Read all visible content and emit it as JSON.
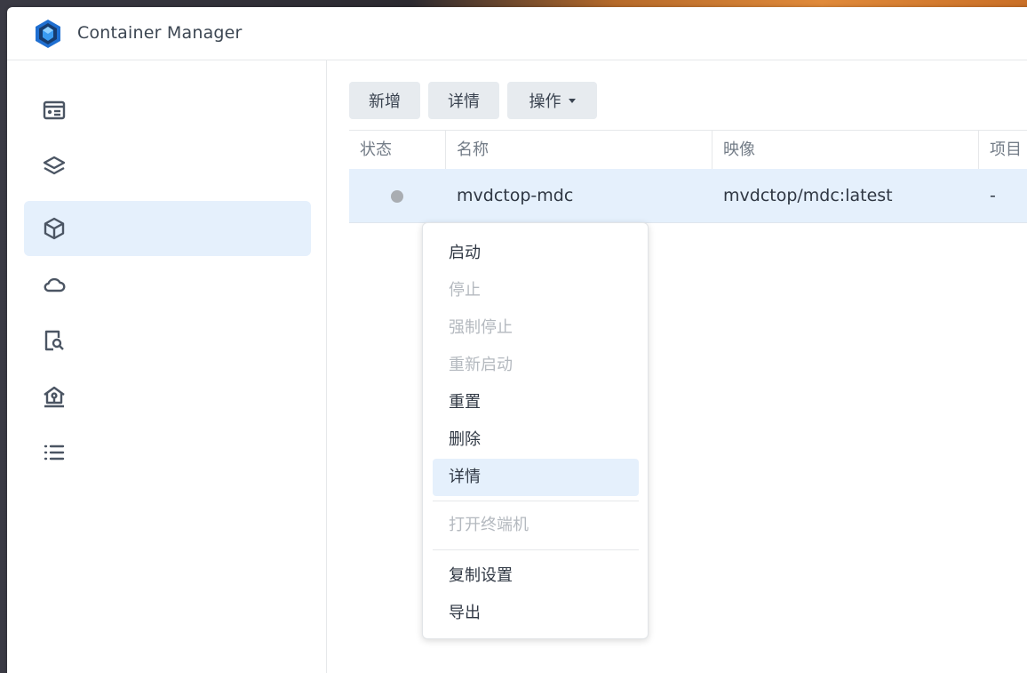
{
  "app": {
    "title": "Container Manager"
  },
  "sidebar": {
    "items": [
      {
        "icon": "overview-icon",
        "active": false
      },
      {
        "icon": "layers-icon",
        "active": false
      },
      {
        "icon": "container-icon",
        "active": true
      },
      {
        "icon": "cloud-icon",
        "active": false
      },
      {
        "icon": "document-search-icon",
        "active": false
      },
      {
        "icon": "network-house-icon",
        "active": false
      },
      {
        "icon": "list-icon",
        "active": false
      }
    ]
  },
  "toolbar": {
    "add_label": "新增",
    "details_label": "详情",
    "actions_label": "操作"
  },
  "table": {
    "columns": [
      "状态",
      "名称",
      "映像",
      "项目"
    ],
    "rows": [
      {
        "status": "stopped",
        "name": "mvdctop-mdc",
        "image": "mvdctop/mdc:latest",
        "project": "-"
      }
    ]
  },
  "context_menu": {
    "items": [
      {
        "label": "启动",
        "disabled": false
      },
      {
        "label": "停止",
        "disabled": true
      },
      {
        "label": "强制停止",
        "disabled": true
      },
      {
        "label": "重新启动",
        "disabled": true
      },
      {
        "label": "重置",
        "disabled": false
      },
      {
        "label": "删除",
        "disabled": false
      },
      {
        "label": "详情",
        "disabled": false,
        "highlighted": true
      },
      {
        "label": "打开终端机",
        "disabled": true
      },
      {
        "label": "复制设置",
        "disabled": false
      },
      {
        "label": "导出",
        "disabled": false
      }
    ]
  },
  "colors": {
    "accent_bg": "#e5f0fc",
    "disabled_text": "#b4b9bf",
    "status_stopped": "#a9adb2"
  }
}
